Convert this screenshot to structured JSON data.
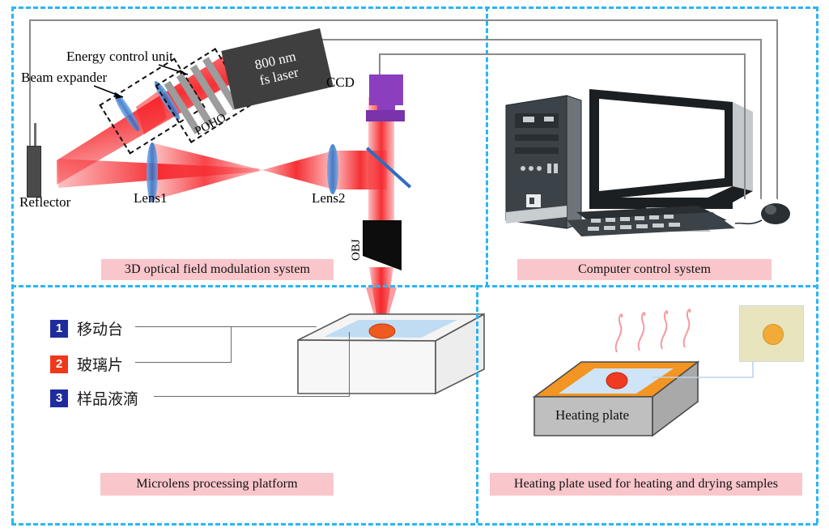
{
  "figure": {
    "title": "Femtosecond laser microlens fabrication setup",
    "panel_border_color": "#29b6f6",
    "caption_bg": "#f9c6cb"
  },
  "panels": [
    {
      "id": "optical",
      "caption": "3D optical field modulation system"
    },
    {
      "id": "computer",
      "caption": "Computer control system"
    },
    {
      "id": "platform",
      "caption": "Microlens processing platform"
    },
    {
      "id": "heating",
      "caption": "Heating plate used for heating and drying samples"
    }
  ],
  "optical": {
    "laser_label_line1": "800 nm",
    "laser_label_line2": "fs laser",
    "beam_expander": "Beam expander",
    "energy_control_unit": "Energy control unit",
    "poho": "POHO",
    "reflector": "Reflector",
    "lens1": "Lens1",
    "lens2": "Lens2",
    "ccd": "CCD",
    "obj": "OBJ",
    "beam_color": "#f5252a",
    "lens_color": "#3f7fd0",
    "laser_box_color": "#3f3f3f",
    "ccd_color": "#8b3fbe"
  },
  "platform": {
    "legend": [
      {
        "num": "1",
        "label": "移动台",
        "badge_color": "#1f2c9e"
      },
      {
        "num": "2",
        "label": "玻璃片",
        "badge_color": "#f0381b"
      },
      {
        "num": "3",
        "label": "样品液滴",
        "badge_color": "#1f2c9e"
      }
    ],
    "stage_top_color": "#f4f4f4",
    "glass_color": "#bfdcf2",
    "droplet_color": "#ee5a1f"
  },
  "heating": {
    "plate_label": "Heating plate",
    "plate_top_color": "#f29522",
    "plate_body_color": "#bfbfbf",
    "glass_color": "#cfe4f6",
    "droplet_color": "#ee3b22",
    "heat_wave_color": "#f59aa0",
    "heat_wave_count": 4,
    "sample_inset_bg": "#e8e4bd",
    "sample_inset_droplet": "#f2ab38"
  },
  "computer": {
    "device": "desktop-computer",
    "parts": [
      "tower",
      "monitor",
      "keyboard",
      "mouse"
    ]
  }
}
